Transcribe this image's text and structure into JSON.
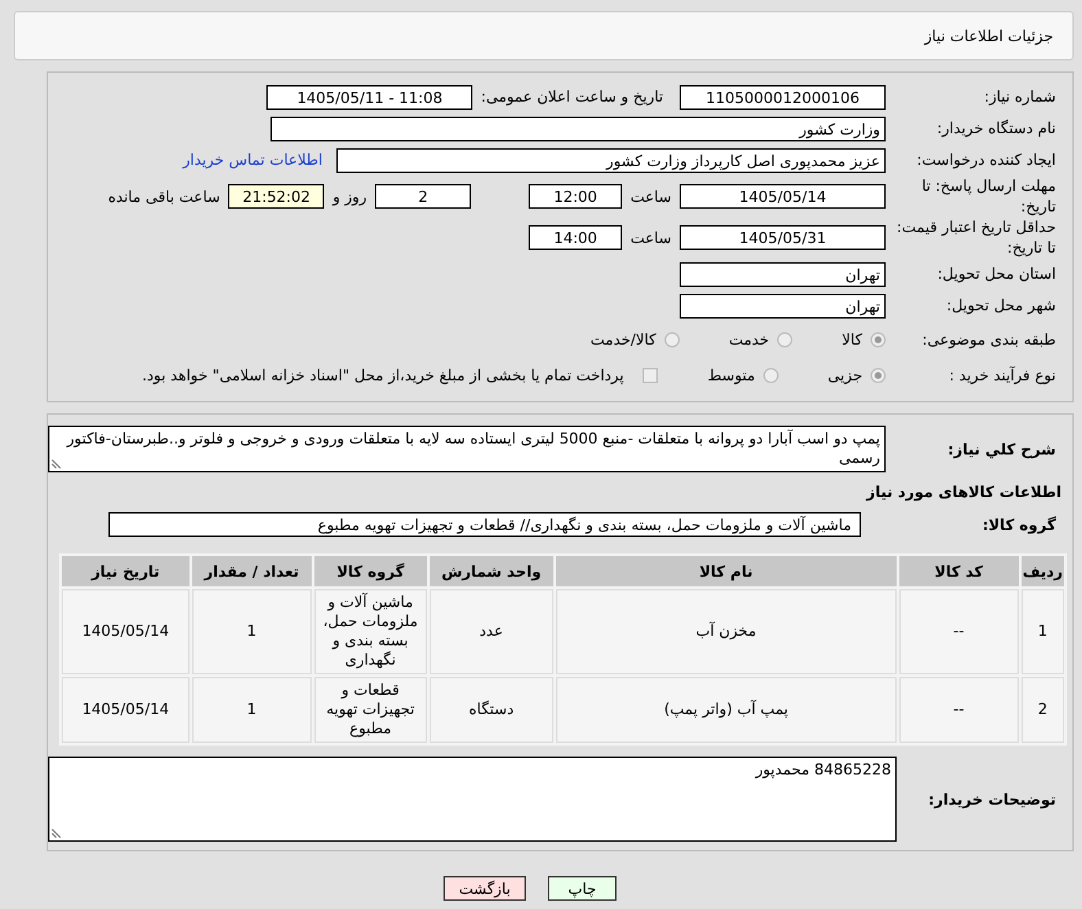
{
  "header": {
    "title": "جزئیات اطلاعات نیاز"
  },
  "need_number": {
    "label": "شماره نیاز:",
    "value": "1105000012000106"
  },
  "announce": {
    "label": "تاریخ و ساعت اعلان عمومی:",
    "value": "1405/05/11 - 11:08"
  },
  "buyer_org": {
    "label": "نام دستگاه خریدار:",
    "value": "وزارت کشور"
  },
  "requester": {
    "label": "ایجاد کننده درخواست:",
    "value": "عزیز محمدپوری اصل کارپرداز وزارت کشور",
    "link": "اطلاعات تماس خریدار"
  },
  "reply_deadline": {
    "label": "مهلت ارسال پاسخ: تا تاریخ:",
    "date": "1405/05/14",
    "time_label": "ساعت",
    "time": "12:00",
    "days": "2",
    "days_label": "روز و",
    "remaining": "21:52:02",
    "remaining_label": "ساعت باقی مانده"
  },
  "price_validity": {
    "label": "حداقل تاریخ اعتبار قیمت: تا تاریخ:",
    "date": "1405/05/31",
    "time_label": "ساعت",
    "time": "14:00"
  },
  "province": {
    "label": "استان محل تحویل:",
    "value": "تهران"
  },
  "city": {
    "label": "شهر محل تحویل:",
    "value": "تهران"
  },
  "category": {
    "label": "طبقه بندی موضوعی:",
    "options": [
      {
        "label": "کالا",
        "selected": true
      },
      {
        "label": "خدمت",
        "selected": false
      },
      {
        "label": "کالا/خدمت",
        "selected": false
      }
    ]
  },
  "process": {
    "label": "نوع فرآیند خرید :",
    "options": [
      {
        "label": "جزیی",
        "selected": true
      },
      {
        "label": "متوسط",
        "selected": false
      }
    ],
    "payment": {
      "label": "پرداخت تمام یا بخشی از مبلغ خرید،از محل \"اسناد خزانه اسلامی\" خواهد بود.",
      "checked": false
    }
  },
  "description": {
    "label": "شرح کلي نياز:",
    "value": "پمپ دو اسب آبارا دو پروانه با متعلقات -منبع 5000 لیتری ایستاده سه لایه با متعلقات ورودی و خروجی و فلوتر و..طبرستان-فاکتور رسمی"
  },
  "goods_title": "اطلاعات کالاهای مورد نیاز",
  "goods_group": {
    "label": "گروه کالا:",
    "value": "ماشین آلات و ملزومات حمل، بسته بندی و نگهداری//  قطعات و تجهیزات تهویه مطبوع"
  },
  "table": {
    "columns": [
      "ردیف",
      "کد کالا",
      "نام کالا",
      "واحد شمارش",
      "گروه کالا",
      "تعداد / مقدار",
      "تاریخ نیاز"
    ],
    "rows": [
      [
        "1",
        "--",
        "مخزن آب",
        "عدد",
        "ماشین آلات و ملزومات حمل، بسته بندی و نگهداری",
        "1",
        "1405/05/14"
      ],
      [
        "2",
        "--",
        "پمپ آب (واتر پمپ)",
        "دستگاه",
        "قطعات و تجهیزات تهویه مطبوع",
        "1",
        "1405/05/14"
      ]
    ]
  },
  "buyer_notes": {
    "label": "توضیحات خریدار:",
    "value": "84865228 محمدپور"
  },
  "buttons": [
    {
      "label": "چاپ",
      "kind": "print"
    },
    {
      "label": "بازگشت",
      "kind": "back"
    }
  ]
}
